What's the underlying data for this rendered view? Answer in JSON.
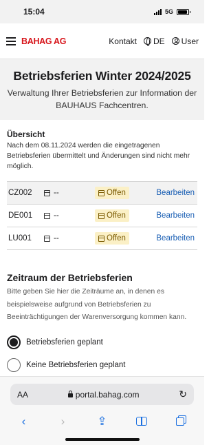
{
  "status_bar": {
    "time": "15:04",
    "network": "5G",
    "battery_level": 0.9
  },
  "header": {
    "logo": "BAHAG AG",
    "contact": "Kontakt",
    "language": "DE",
    "user": "User"
  },
  "hero": {
    "title": "Betriebsferien Winter 2024/2025",
    "subtitle": "Verwaltung Ihrer Betriebsferien zur Information der BAUHAUS Fachcentren."
  },
  "overview": {
    "title": "Übersicht",
    "note": "Nach dem 08.11.2024 werden die eingetragenen Betriebsferien übermittelt und Änderungen sind nicht mehr möglich.",
    "rows": [
      {
        "code": "CZ002",
        "date": "--",
        "status": "Offen",
        "action": "Bearbeiten"
      },
      {
        "code": "DE001",
        "date": "--",
        "status": "Offen",
        "action": "Bearbeiten"
      },
      {
        "code": "LU001",
        "date": "--",
        "status": "Offen",
        "action": "Bearbeiten"
      }
    ]
  },
  "period": {
    "title": "Zeitraum der Betriebsferien",
    "note": "Bitte geben Sie hier die Zeiträume an, in denen es beispielsweise aufgrund von Betriebsferien zu Beeinträchtigungen der Warenversorgung kommen kann.",
    "options": [
      {
        "label": "Betriebsferien geplant",
        "selected": true
      },
      {
        "label": "Keine Betriebsferien geplant",
        "selected": false
      }
    ]
  },
  "browser": {
    "text_size_label": "AA",
    "url": "portal.bahag.com",
    "reload_icon": "reload-icon",
    "toolbar_icons": [
      "back-icon",
      "forward-icon",
      "share-icon",
      "bookmarks-icon",
      "tabs-icon"
    ]
  }
}
